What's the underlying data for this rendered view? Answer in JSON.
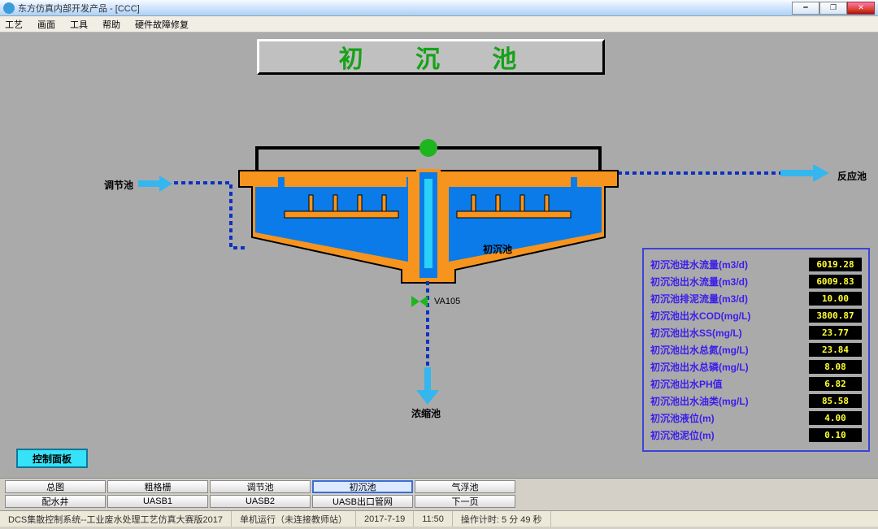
{
  "window": {
    "title": "东方仿真内部开发产品 - [CCC]"
  },
  "menu": {
    "items": [
      "工艺",
      "画面",
      "工具",
      "帮助",
      "硬件故障修复"
    ]
  },
  "banner": {
    "title": "初 沉 池"
  },
  "labels": {
    "left_source": "调节池",
    "right_target": "反应池",
    "tank_name": "初沉池",
    "valve": "VA105",
    "bottom_target": "浓缩池"
  },
  "data_rows": [
    {
      "label": "初沉池进水流量(m3/d)",
      "value": "6019.28"
    },
    {
      "label": "初沉池出水流量(m3/d)",
      "value": "6009.83"
    },
    {
      "label": "初沉池排泥流量(m3/d)",
      "value": "10.00"
    },
    {
      "label": "初沉池出水COD(mg/L)",
      "value": "3800.87"
    },
    {
      "label": "初沉池出水SS(mg/L)",
      "value": "23.77"
    },
    {
      "label": "初沉池出水总氮(mg/L)",
      "value": "23.84"
    },
    {
      "label": "初沉池出水总磷(mg/L)",
      "value": "8.08"
    },
    {
      "label": "初沉池出水PH值",
      "value": "6.82"
    },
    {
      "label": "初沉池出水油类(mg/L)",
      "value": "85.58"
    },
    {
      "label": "初沉池液位(m)",
      "value": "4.00"
    },
    {
      "label": "初沉池泥位(m)",
      "value": "0.10"
    }
  ],
  "control_panel_btn": "控制面板",
  "navtabs": {
    "row1": [
      "总图",
      "粗格栅",
      "调节池",
      "初沉池",
      "气浮池"
    ],
    "row2": [
      "配水井",
      "UASB1",
      "UASB2",
      "UASB出口管网",
      "下一页"
    ],
    "active": "初沉池"
  },
  "status": {
    "sys": "DCS集散控制系统--工业废水处理工艺仿真大赛版2017",
    "mode": "单机运行（未连接教师站）",
    "date": "2017-7-19",
    "time": "11:50",
    "timer": "操作计时: 5 分 49 秒"
  }
}
